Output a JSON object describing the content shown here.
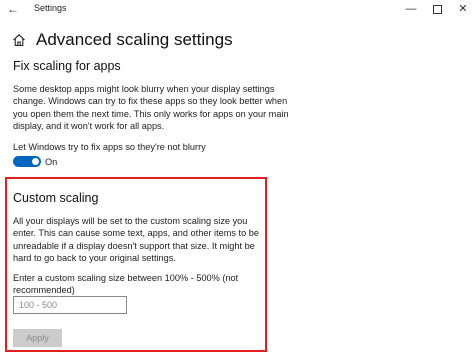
{
  "window": {
    "title": "Settings",
    "back_glyph": "←",
    "minimize_glyph": "—",
    "close_glyph": "✕"
  },
  "page": {
    "title": "Advanced scaling settings",
    "home_icon": "home-icon"
  },
  "fix_scaling": {
    "title": "Fix scaling for apps",
    "description": "Some desktop apps might look blurry when your display settings change. Windows can try to fix these apps so they look better when you open them the next time. This only works for apps on your main display, and it won't work for all apps.",
    "toggle_label": "Let Windows try to fix apps so they're not blurry",
    "toggle_state": "On",
    "toggle_on": true,
    "toggle_color": "#0067c0"
  },
  "custom_scaling": {
    "title": "Custom scaling",
    "description": "All your displays will be set to the custom scaling size you enter. This can cause some text, apps, and other items to be unreadable if a display doesn't support that size. It might be hard to go back to your original settings.",
    "prompt": "Enter a custom scaling size between 100% - 500% (not recommended)",
    "input_placeholder": "100 - 500",
    "input_value": "",
    "apply_label": "Apply",
    "highlight_color": "#e02020"
  }
}
